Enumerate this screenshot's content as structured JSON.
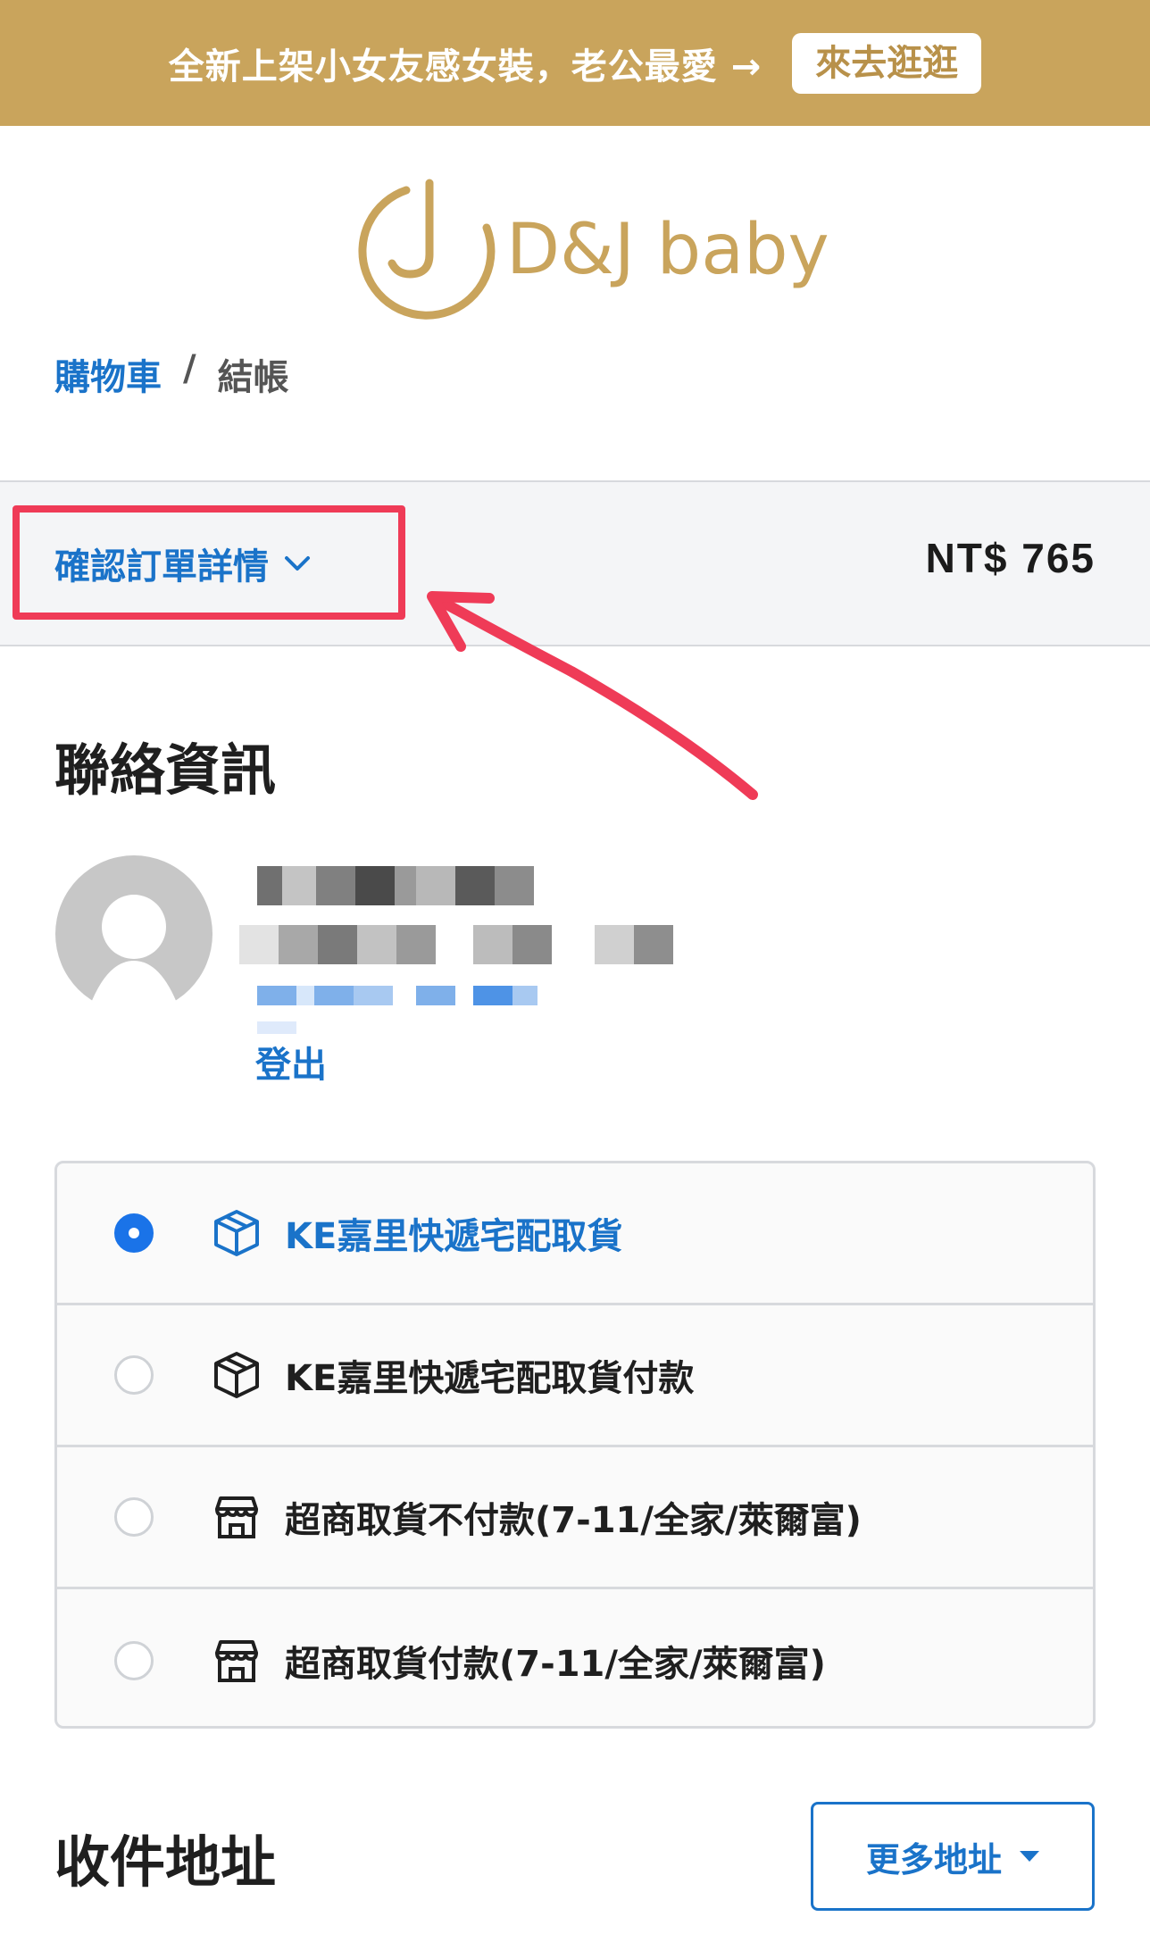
{
  "banner": {
    "text": "全新上架小女友感女裝，老公最愛 →",
    "button_label": "來去逛逛",
    "color": "#c9a45c"
  },
  "logo": {
    "text": "D&J baby",
    "mark": "J"
  },
  "breadcrumb": {
    "cart": "購物車",
    "separator": "/",
    "current": "結帳"
  },
  "summary": {
    "toggle_label": "確認訂單詳情",
    "total": "NT$ 765"
  },
  "contact": {
    "title": "聯絡資訊",
    "logout_label": "登出"
  },
  "shipping": {
    "options": [
      {
        "label": "KE嘉里快遞宅配取貨",
        "icon": "package-icon",
        "selected": true
      },
      {
        "label": "KE嘉里快遞宅配取貨付款",
        "icon": "package-icon",
        "selected": false
      },
      {
        "label": "超商取貨不付款(7-11/全家/萊爾富)",
        "icon": "store-icon",
        "selected": false
      },
      {
        "label": "超商取貨付款(7-11/全家/萊爾富)",
        "icon": "store-icon",
        "selected": false
      }
    ]
  },
  "address": {
    "title": "收件地址",
    "more_button": "更多地址"
  },
  "colors": {
    "accent": "#1a73c9",
    "highlight": "#ef3b57",
    "brand": "#c9a45c"
  }
}
